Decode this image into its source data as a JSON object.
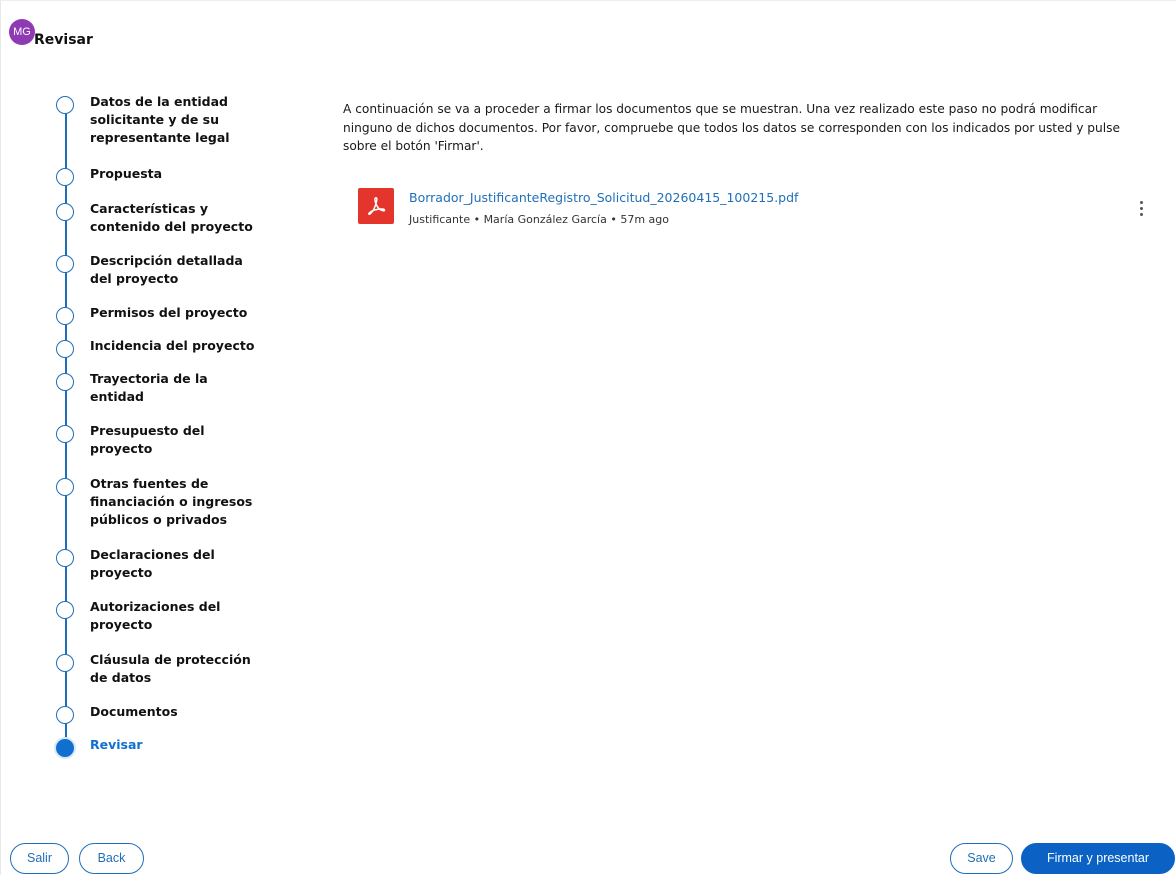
{
  "header": {
    "avatar_initials": "MG",
    "title": "Revisar",
    "avatar_color": "#8e3ab3"
  },
  "stepper": {
    "accent_color": "#1170cf",
    "steps": [
      {
        "label": "Datos de la entidad solicitante y de su representante legal",
        "state": "pending"
      },
      {
        "label": "Propuesta",
        "state": "pending"
      },
      {
        "label": "Características y contenido del proyecto",
        "state": "pending"
      },
      {
        "label": "Descripción detallada del proyecto",
        "state": "pending"
      },
      {
        "label": "Permisos del proyecto",
        "state": "pending"
      },
      {
        "label": "Incidencia del proyecto",
        "state": "pending"
      },
      {
        "label": "Trayectoria de la entidad",
        "state": "pending"
      },
      {
        "label": "Presupuesto del proyecto",
        "state": "pending"
      },
      {
        "label": "Otras fuentes de financiación o ingresos públicos o privados",
        "state": "pending"
      },
      {
        "label": "Declaraciones del proyecto",
        "state": "pending"
      },
      {
        "label": "Autorizaciones del proyecto",
        "state": "pending"
      },
      {
        "label": "Cláusula de protección de datos",
        "state": "pending"
      },
      {
        "label": "Documentos",
        "state": "pending"
      },
      {
        "label": "Revisar",
        "state": "active"
      }
    ]
  },
  "main": {
    "intro_text": "A continuación se va a proceder a firmar los documentos que se muestran. Una vez realizado este paso no podrá modificar ninguno de dichos documentos. Por favor, compruebe que todos los datos se corresponden con los indicados por usted y pulse sobre el botón 'Firmar'.",
    "document": {
      "icon": "pdf-icon",
      "name": "Borrador_JustificanteRegistro_Solicitud_20260415_100215.pdf",
      "meta": "Justificante • María González García • 57m ago"
    }
  },
  "footer": {
    "exit_label": "Salir",
    "back_label": "Back",
    "save_label": "Save",
    "submit_label": "Firmar y presentar"
  }
}
